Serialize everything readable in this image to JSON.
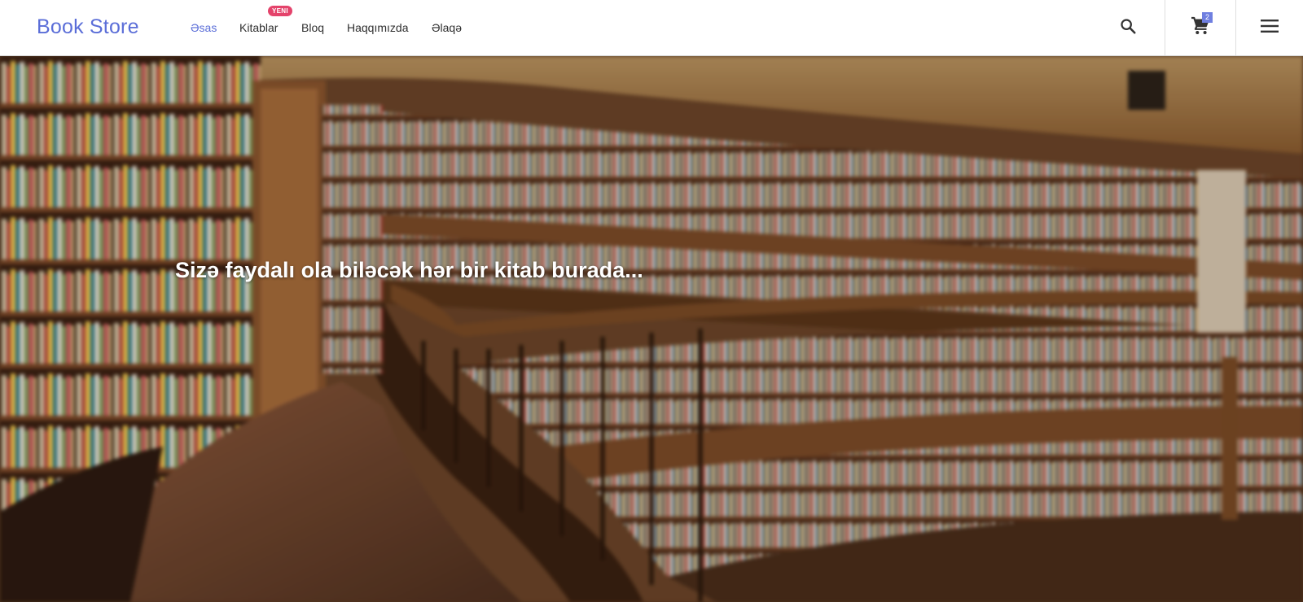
{
  "brand": {
    "name": "Book Store",
    "color": "#5b6ed8"
  },
  "nav": {
    "items": [
      {
        "label": "Əsas",
        "active": true
      },
      {
        "label": "Kitablar",
        "badge": "YENI"
      },
      {
        "label": "Bloq"
      },
      {
        "label": "Haqqımızda"
      },
      {
        "label": "Əlaqə"
      }
    ]
  },
  "actions": {
    "search_icon": "search-icon",
    "cart_icon": "cart-icon",
    "cart_count": "2",
    "menu_icon": "hamburger-menu-icon"
  },
  "hero": {
    "title": "Sizə faydalı ola biləcək hər bir kitab burada...",
    "background": "library-bookshelves-photo"
  },
  "colors": {
    "accent": "#5b6ed8",
    "badge": "#e4436b",
    "cart_badge": "#6f7fe0"
  }
}
